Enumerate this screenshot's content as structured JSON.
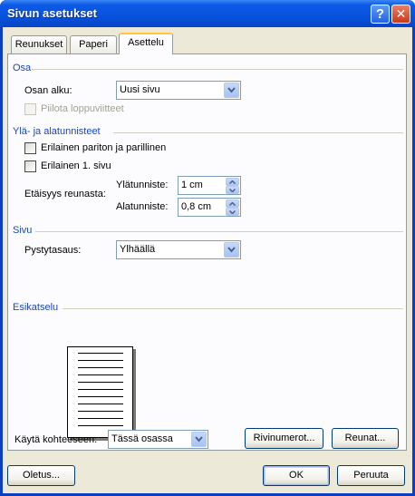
{
  "window": {
    "title": "Sivun asetukset",
    "help_glyph": "?",
    "close_glyph": "✕"
  },
  "tabs": [
    {
      "label": "Reunukset",
      "active": false
    },
    {
      "label": "Paperi",
      "active": false
    },
    {
      "label": "Asettelu",
      "active": true
    }
  ],
  "section": {
    "title": "Osa",
    "start_label": "Osan alku:",
    "start_value": "Uusi sivu",
    "hide_endnotes_label": "Piilota loppuviitteet",
    "hide_endnotes_checked": false,
    "hide_endnotes_enabled": false
  },
  "headers_footers": {
    "title": "Ylä- ja alatunnisteet",
    "odd_even_label": "Erilainen pariton ja parillinen",
    "odd_even_checked": false,
    "first_page_label": "Erilainen 1. sivu",
    "first_page_checked": false,
    "distance_label": "Etäisyys reunasta:",
    "header_label": "Ylätunniste:",
    "header_value": "1 cm",
    "footer_label": "Alatunniste:",
    "footer_value": "0,8 cm"
  },
  "page": {
    "title": "Sivu",
    "valign_label": "Pystytasaus:",
    "valign_value": "Ylhäällä"
  },
  "preview": {
    "title": "Esikatselu"
  },
  "apply": {
    "label": "Käytä kohteeseen:",
    "value": "Tässä osassa"
  },
  "buttons": {
    "line_numbers": "Rivinumerot...",
    "borders": "Reunat...",
    "default": "Oletus...",
    "ok": "OK",
    "cancel": "Peruuta"
  },
  "colors": {
    "title_bar": "#0752dd",
    "dialog_bg": "#ece9d8",
    "group_title": "#1a47b8",
    "active_tab_highlight": "#ffc83c"
  }
}
